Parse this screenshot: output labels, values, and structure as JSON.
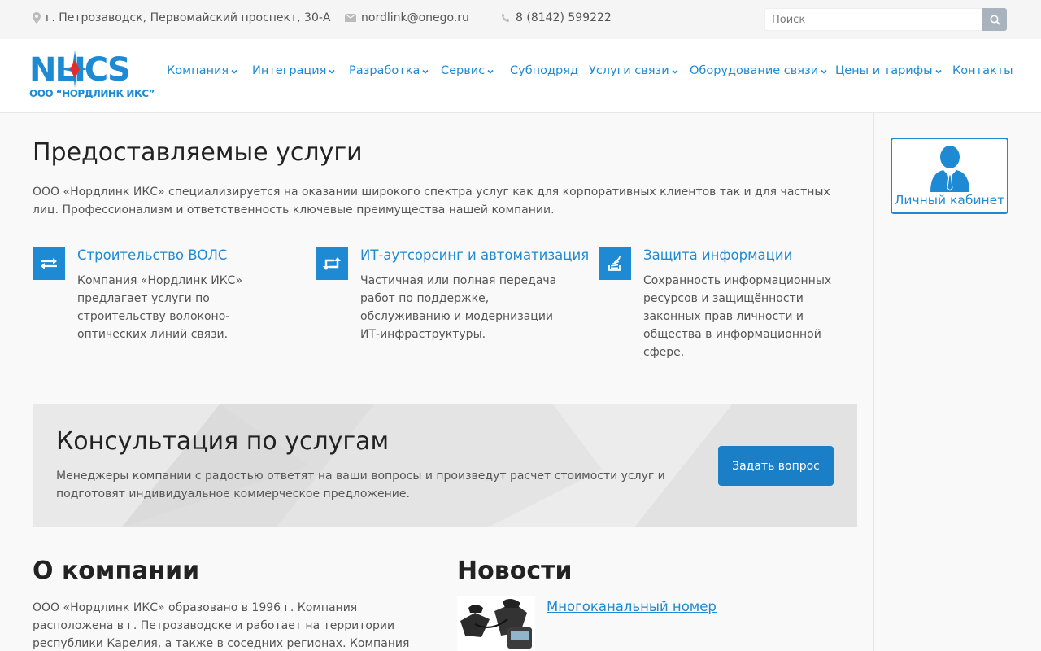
{
  "topbar": {
    "address": "г. Петрозаводск, Первомайский проспект, 30-А",
    "email": "nordlink@onego.ru",
    "phone": "8 (8142) 599222",
    "search_placeholder": "Поиск"
  },
  "logo": {
    "brand": "NLICS",
    "sub": "ООО “НОРДЛИНК ИКС”"
  },
  "nav": [
    {
      "label": "Компания",
      "dropdown": true
    },
    {
      "label": "Интеграция",
      "dropdown": true
    },
    {
      "label": "Разработка",
      "dropdown": true
    },
    {
      "label": "Сервис",
      "dropdown": true
    },
    {
      "label": "Субподряд",
      "dropdown": false
    },
    {
      "label": "Услуги связи",
      "dropdown": true
    },
    {
      "label": "Оборудование связи",
      "dropdown": true
    },
    {
      "label": "Цены и тарифы",
      "dropdown": true
    },
    {
      "label": "Контакты",
      "dropdown": false
    }
  ],
  "main": {
    "title": "Предоставляемые услуги",
    "intro": "ООО «Нордлинк ИКС» специализируется на оказании широкого спектра услуг как для корпоративных клиентов так и для частных лиц. Профессионализм и ответственность ключевые преимущества нашей компании."
  },
  "services": [
    {
      "title": "Строительство ВОЛС",
      "description": "Компания «Нордлинк ИКС» предлагает услуги по строительству волоконо-оптических линий связи.",
      "icon": "exchange-arrows-icon"
    },
    {
      "title": "ИТ-аутсорсинг и автоматизация",
      "description": "Частичная или полная передача работ по поддержке, обслуживанию и модернизации ИТ-инфраструктуры.",
      "icon": "retweet-icon"
    },
    {
      "title": "Защита информации",
      "description": "Сохранность информационных ресурсов и защищённости законных прав личности и общества в информационной сфере.",
      "icon": "stack-icon"
    }
  ],
  "consult": {
    "title": "Консультация по услугам",
    "description": "Менеджеры компании с радостью ответят на ваши вопросы и произведут расчет стоимости услуг и подготовят индивидуальное коммерческое предложение.",
    "button": "Задать вопрос"
  },
  "about": {
    "title": "О компании",
    "text": "ООО «Нордлинк ИКС» образовано в 1996 г. Компания расположена в г. Петрозаводске и работает на территории республики Карелия, а также в соседних  регионах. Компания специализируется в оказании"
  },
  "news": {
    "title": "Новости",
    "item_title": "Многоканальный номер"
  },
  "sidebar": {
    "cabinet_label": "Личный кабинет"
  },
  "colors": {
    "accent": "#1f8ad4",
    "button": "#1a7fc6",
    "heading": "#222222",
    "text": "#555555"
  }
}
